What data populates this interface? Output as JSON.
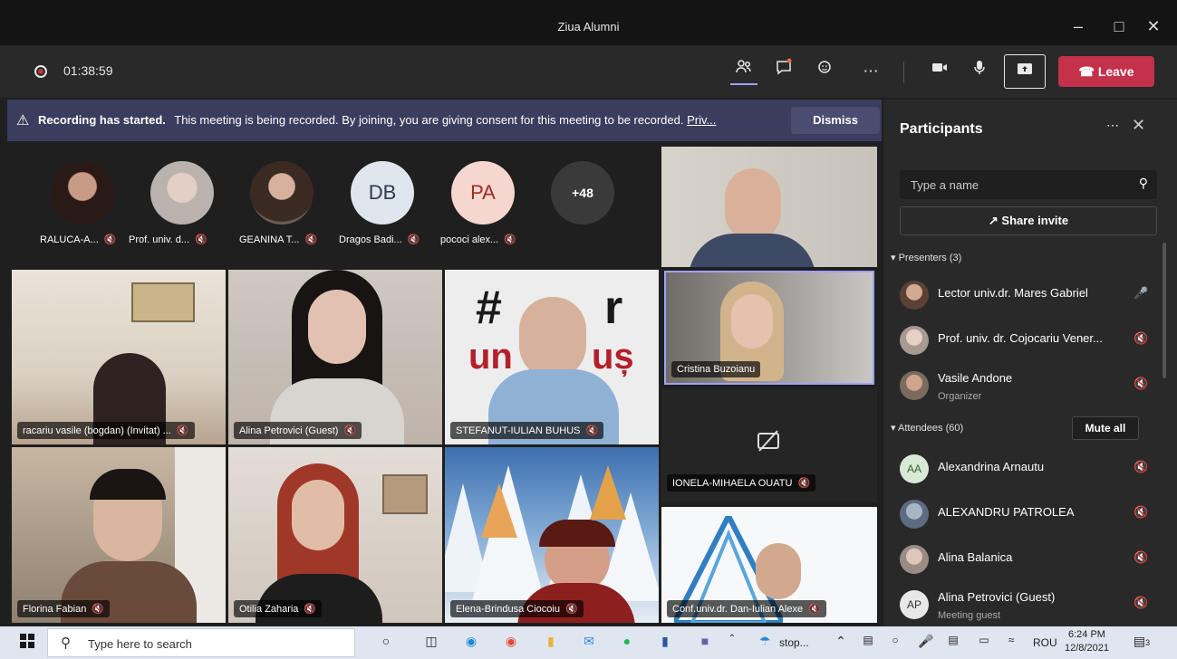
{
  "window": {
    "title": "Ziua Alumni"
  },
  "toolbar": {
    "timer": "01:38:59",
    "leave_label": "Leave"
  },
  "banner": {
    "bold": "Recording has started.",
    "text": "This meeting is being recorded. By joining, you are giving consent for this meeting to be recorded.",
    "link": "Priv...",
    "dismiss_label": "Dismiss"
  },
  "avatar_strip": [
    {
      "name": "RALUCA-A..."
    },
    {
      "name": "Prof. univ. d..."
    },
    {
      "name": "GEANINA T..."
    },
    {
      "name": "Dragos Badi...",
      "initials": "DB"
    },
    {
      "name": "pococi alex...",
      "initials": "PA"
    },
    {
      "overflow": "+48"
    }
  ],
  "tiles": [
    {
      "name": "racariu vasile (bogdan) (Invitat) ..."
    },
    {
      "name": "Alina Petrovici (Guest)"
    },
    {
      "name": "STEFANUT-IULIAN BUHUS"
    },
    {
      "name": "Cristina Buzoianu"
    },
    {
      "name": "IONELA-MIHAELA OUATU"
    },
    {
      "name": "Florina Fabian"
    },
    {
      "name": "Otilia Zaharia"
    },
    {
      "name": "Elena-Brindusa Ciocoiu"
    },
    {
      "name": "Conf.univ.dr. Dan-Iulian Alexe"
    }
  ],
  "sign_text": {
    "line1": "#",
    "line1b": "r",
    "line2": "un",
    "line2b": "uș"
  },
  "participants": {
    "title": "Participants",
    "search_placeholder": "Type a name",
    "share_invite": "Share invite",
    "presenters_header": "Presenters (3)",
    "attendees_header": "Attendees (60)",
    "mute_all": "Mute all",
    "presenters": [
      {
        "name": "Lector univ.dr. Mares Gabriel"
      },
      {
        "name": "Prof. univ. dr. Cojocariu Vener..."
      },
      {
        "name": "Vasile Andone",
        "sub": "Organizer"
      }
    ],
    "attendees": [
      {
        "name": "Alexandrina Arnautu",
        "initials": "AA"
      },
      {
        "name": "ALEXANDRU PATROLEA"
      },
      {
        "name": "Alina Balanica"
      },
      {
        "name": "Alina Petrovici (Guest)",
        "initials": "AP",
        "sub": "Meeting guest"
      }
    ]
  },
  "taskbar": {
    "search_placeholder": "Type here to search",
    "stop_label": "stop...",
    "lang": "ROU",
    "time": "6:24 PM",
    "date": "12/8/2021",
    "notifications": "3"
  }
}
